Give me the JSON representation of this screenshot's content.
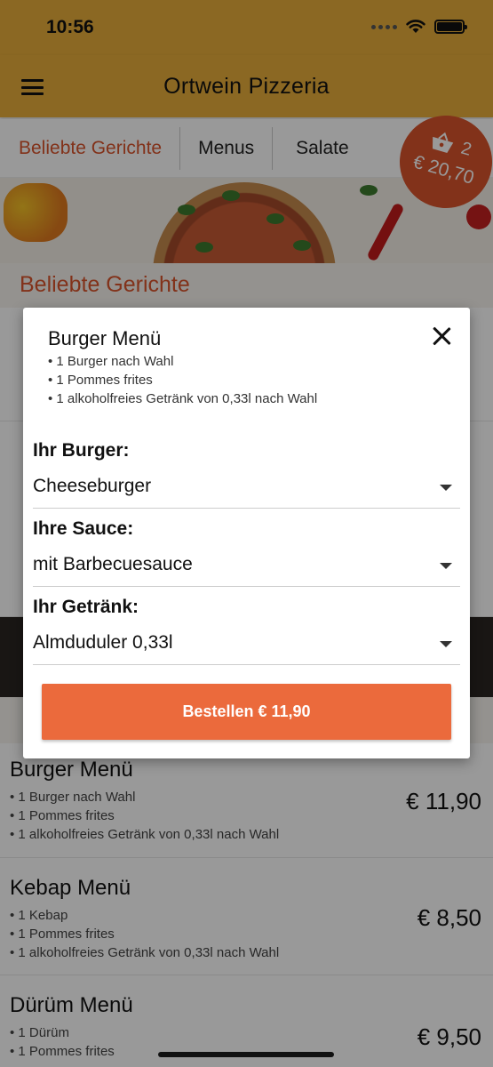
{
  "status": {
    "time": "10:56"
  },
  "header": {
    "title": "Ortwein Pizzeria"
  },
  "tabs": [
    {
      "label": "Beliebte Gerichte"
    },
    {
      "label": "Menus"
    },
    {
      "label": "Salate"
    }
  ],
  "cart": {
    "count": "2",
    "total": "€ 20,70"
  },
  "sections": {
    "popular": "Beliebte Gerichte"
  },
  "background_items": [
    {
      "name": "Burger Menü",
      "lines": [
        "• 1 Burger nach Wahl",
        "• 1 Pommes frites",
        "• 1 alkoholfreies Getränk von 0,33l nach Wahl"
      ],
      "price": "€ 11,90"
    },
    {
      "name": "Kebap Menü",
      "lines": [
        "• 1 Kebap",
        "• 1 Pommes frites",
        "• 1 alkoholfreies Getränk von 0,33l nach Wahl"
      ],
      "price": "€ 8,50"
    },
    {
      "name": "Dürüm Menü",
      "lines": [
        "• 1 Dürüm",
        "• 1 Pommes frites"
      ],
      "price": "€ 9,50"
    }
  ],
  "modal": {
    "title": "Burger Menü",
    "desc": [
      "• 1 Burger nach Wahl",
      "• 1 Pommes frites",
      "• 1 alkoholfreies Getränk von 0,33l nach Wahl"
    ],
    "fields": [
      {
        "label": "Ihr Burger:",
        "value": "Cheeseburger"
      },
      {
        "label": "Ihre Sauce:",
        "value": "mit Barbecuesauce"
      },
      {
        "label": "Ihr Getränk:",
        "value": "Almduduler 0,33l"
      }
    ],
    "order_label": "Bestellen € 11,90"
  },
  "colors": {
    "header": "#e8ad3b",
    "accent": "#d9542c",
    "button": "#eb6a3c"
  }
}
